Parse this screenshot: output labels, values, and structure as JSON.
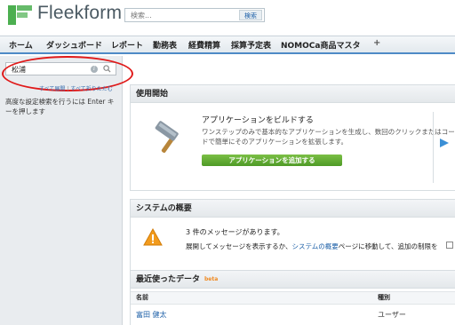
{
  "header": {
    "logo_text": "Fleekform",
    "search_placeholder": "検索...",
    "search_button": "検索"
  },
  "nav": {
    "items": [
      {
        "label": "ホーム"
      },
      {
        "label": "ダッシュボード"
      },
      {
        "label": "レポート"
      },
      {
        "label": "勤務表"
      },
      {
        "label": "経費精算"
      },
      {
        "label": "採算予定表"
      },
      {
        "label": "NOMOCa商品マスタ"
      }
    ],
    "add_tab": "+"
  },
  "sidebar": {
    "quickfind_value": "松浦",
    "info_glyph": "i",
    "expand_all": "すべて展開",
    "separator": "|",
    "collapse_all": "すべて折りたたむ",
    "hint": "高度な設定検索を行うには Enter キーを押します"
  },
  "getting_started": {
    "header": "使用開始",
    "title": "アプリケーションをビルドする",
    "description": "ワンステップのみで基本的なアプリケーションを生成し、数回のクリックまたはコードで簡単にそのアプリケーションを拡張します。",
    "button": "アプリケーションを追加する"
  },
  "system_overview": {
    "header": "システムの概要",
    "message_count": "3 件のメッセージがあります。",
    "message_prefix": "展開してメッセージを表示するか、",
    "message_link": "システムの概要",
    "message_suffix": "ページに移動して、追加の制限を"
  },
  "recent": {
    "header": "最近使ったデータ",
    "beta": "beta",
    "columns": {
      "name": "名前",
      "type": "種別"
    },
    "rows": [
      {
        "name": "富田 健太",
        "type": "ユーザー"
      }
    ]
  },
  "colors": {
    "accent_blue": "#4e8ac6",
    "button_green": "#5aa52f",
    "link_blue": "#1c5fa7",
    "highlight_red": "#e01a1a",
    "warning_orange": "#f29b1d"
  }
}
